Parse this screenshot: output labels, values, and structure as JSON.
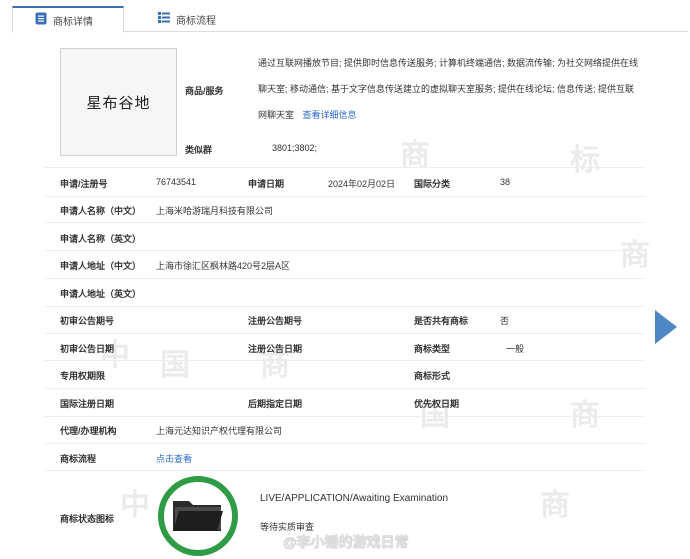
{
  "tabs": [
    {
      "label": "商标详情",
      "icon": "document-icon",
      "active": true
    },
    {
      "label": "商标流程",
      "icon": "list-icon",
      "active": false
    }
  ],
  "mark_image_text": "星布谷地",
  "goods": {
    "label": "商品/服务",
    "text": "通过互联网播放节目; 提供即时信息传送服务; 计算机终端通信; 数据流传输; 为社交网络提供在线聊天室; 移动通信; 基于文字信息传送建立的虚拟聊天室服务; 提供在线论坛; 信息传送; 提供互联网聊天室",
    "more_link": "查看详细信息"
  },
  "similar_group": {
    "label": "类似群",
    "value": "3801;3802;"
  },
  "fields": {
    "reg_no_label": "申请/注册号",
    "reg_no": "76743541",
    "app_date_label": "申请日期",
    "app_date": "2024年02月02日",
    "intl_class_label": "国际分类",
    "intl_class": "38",
    "applicant_cn_label": "申请人名称（中文）",
    "applicant_cn": "上海米哈游瑞月科技有限公司",
    "applicant_en_label": "申请人名称（英文）",
    "address_cn_label": "申请人地址（中文）",
    "address_cn": "上海市徐汇区枫林路420号2层A区",
    "address_en_label": "申请人地址（英文）",
    "prelim_no_label": "初审公告期号",
    "reg_pub_no_label": "注册公告期号",
    "shared_label": "是否共有商标",
    "shared": "否",
    "prelim_date_label": "初审公告日期",
    "reg_pub_date_label": "注册公告日期",
    "mark_type_label": "商标类型",
    "mark_type": "一般",
    "exclusive_label": "专用权期限",
    "mark_form_label": "商标形式",
    "intl_reg_date_label": "国际注册日期",
    "later_date_label": "后期指定日期",
    "priority_date_label": "优先权日期",
    "agent_label": "代理/办理机构",
    "agent": "上海元达知识产权代理有限公司",
    "process_label": "商标流程",
    "process_link": "点击查看",
    "status_icon_label": "商标状态图标"
  },
  "status": {
    "en": "LIVE/APPLICATION/Awaiting Examination",
    "cn": "等待实质审查",
    "icon": "folder-icon",
    "ring_color": "#2f9b45"
  },
  "watermark": {
    "text": "中国商标",
    "weibo": "@李小锤的游戏日常"
  },
  "colors": {
    "accent": "#3a6fb5",
    "link": "#2a6ac8",
    "arrow": "#4f86c6"
  }
}
